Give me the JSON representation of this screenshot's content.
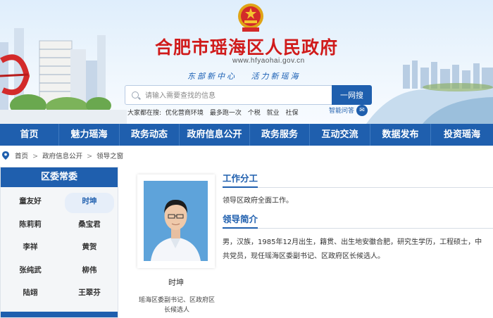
{
  "header": {
    "site_title": "合肥市瑶海区人民政府",
    "site_url": "www.hfyaohai.gov.cn",
    "slogan": [
      "东部新中心",
      "活力新瑶海"
    ],
    "search": {
      "placeholder": "请输入需要查找的信息",
      "button_label": "一网搜"
    },
    "hot_label": "大家都在搜:",
    "hot_terms": [
      "优化营商环境",
      "最多跑一次",
      "个税",
      "就业",
      "社保"
    ],
    "smart_qa_label": "智能问答",
    "emblem_icon": "national-emblem-icon"
  },
  "nav": {
    "items": [
      "首页",
      "魅力瑶海",
      "政务动态",
      "政府信息公开",
      "政务服务",
      "互动交流",
      "数据发布",
      "投资瑶海"
    ]
  },
  "breadcrumb": {
    "items": [
      "首页",
      "政府信息公开",
      "领导之窗"
    ],
    "separator": ">"
  },
  "sidebar": {
    "heading": "区委常委",
    "leaders": [
      "童友好",
      "时坤",
      "陈莉莉",
      "桑宝君",
      "李祥",
      "黄贺",
      "张纯武",
      "柳伟",
      "陆翊",
      "王翠芬"
    ],
    "active_index": 1
  },
  "profile": {
    "name": "时坤",
    "title": "瑶海区委副书记、区政府区长候选人",
    "duty_heading": "工作分工",
    "duty_text": "领导区政府全面工作。",
    "bio_heading": "领导简介",
    "bio_text": "男，汉族，1985年12月出生，籍贯、出生地安徽合肥，研究生学历，工程硕士，中共党员，现任瑶海区委副书记、区政府区长候选人。"
  },
  "colors": {
    "brand_blue": "#1f5fae",
    "title_red": "#d01b1b"
  }
}
